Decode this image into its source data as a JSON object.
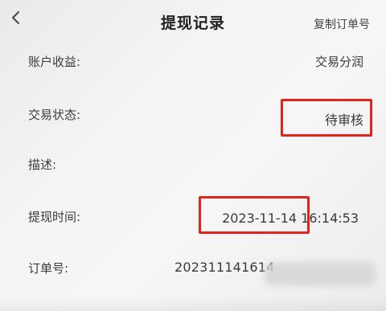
{
  "header": {
    "title": "提现记录",
    "back_icon": "chevron-left-icon",
    "copy_label": "复制订单号"
  },
  "details": {
    "account_earnings": {
      "label": "账户收益:",
      "value": "交易分润"
    },
    "transaction_status": {
      "label": "交易状态:",
      "value": "待审核"
    },
    "description": {
      "label": "描述:",
      "value": ""
    },
    "withdraw_time": {
      "label": "提现时间:",
      "value": "2023-11-14 16:14:53"
    },
    "order_number": {
      "label": "订单号:",
      "value": "202311141614"
    }
  },
  "colors": {
    "highlight_box": "#e1251b"
  }
}
